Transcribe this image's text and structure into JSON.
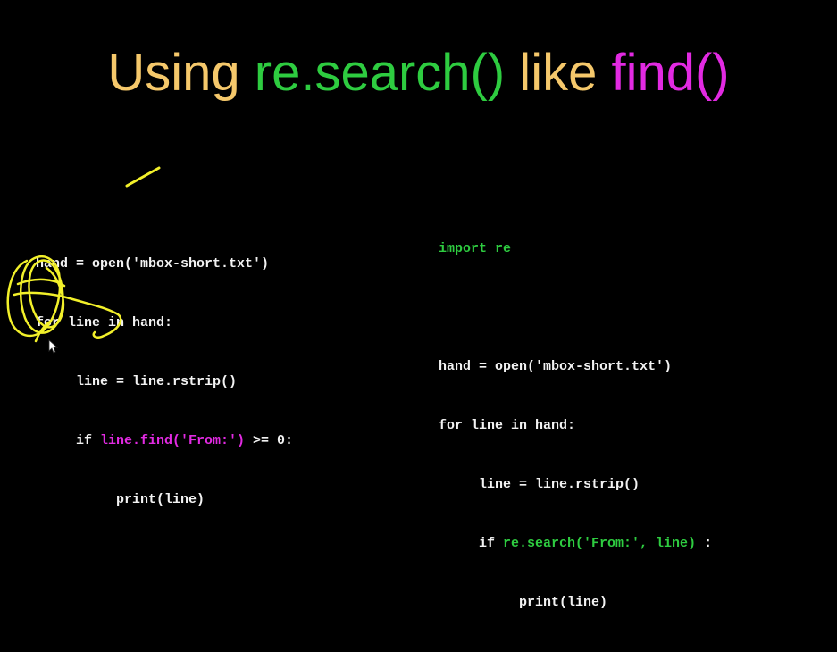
{
  "slide": {
    "title": {
      "part1": "Using ",
      "part2": "re.search()",
      "part3": " like ",
      "part4": "find()"
    },
    "left_code": {
      "line1": "hand = open('mbox-short.txt')",
      "line2": "for line in hand:",
      "line3": "line = line.rstrip()",
      "line4_kw": "if ",
      "line4_call": "line.find('From:')",
      "line4_rest": " >= 0:",
      "line5": "print(line)"
    },
    "right_code": {
      "import_line": "import re",
      "line1": "hand = open('mbox-short.txt')",
      "line2": "for line in hand:",
      "line3": "line = line.rstrip()",
      "line4_kw": "if ",
      "line4_call": "re.search('From:', line)",
      "line4_rest": " :",
      "line5": "print(line)"
    }
  },
  "colors": {
    "background": "#000000",
    "title_yellow": "#f5c86b",
    "green": "#2ecc40",
    "magenta": "#e22ae2",
    "code_text": "#f2f2f2",
    "annotation": "#f2f02a"
  }
}
